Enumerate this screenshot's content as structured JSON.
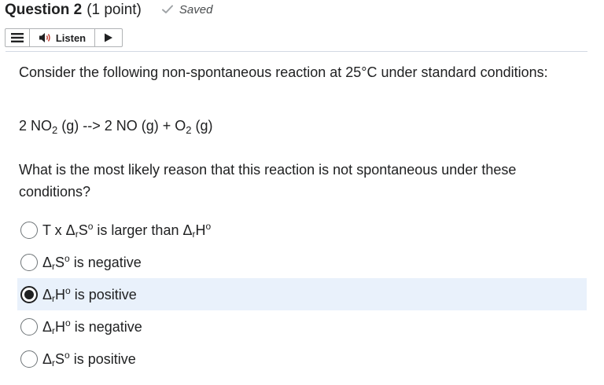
{
  "header": {
    "question_label": "Question 2",
    "points": "(1 point)",
    "saved_label": "Saved"
  },
  "listen": {
    "label": "Listen"
  },
  "question": {
    "intro": "Consider the following non-spontaneous reaction at 25°C under standard conditions:",
    "equation": {
      "reactant_coef": "2 NO",
      "reactant_sub": "2",
      "reactant_state": " (g) --> 2 NO (g) + O",
      "product_sub": "2",
      "product_state": " (g)"
    },
    "prompt": "What is the most likely reason that this reaction is not spontaneous under these conditions?"
  },
  "options": [
    {
      "pre": "T x Δ",
      "sub1": "r",
      "mid1": "S",
      "sup1": "o",
      "mid2": " is larger than Δ",
      "sub2": "r",
      "mid3": "H",
      "sup2": "o",
      "post": "",
      "selected": false
    },
    {
      "pre": "Δ",
      "sub1": "r",
      "mid1": "S",
      "sup1": "o",
      "mid2": " is negative",
      "sub2": "",
      "mid3": "",
      "sup2": "",
      "post": "",
      "selected": false
    },
    {
      "pre": "Δ",
      "sub1": "r",
      "mid1": "H",
      "sup1": "o",
      "mid2": " is positive",
      "sub2": "",
      "mid3": "",
      "sup2": "",
      "post": "",
      "selected": true
    },
    {
      "pre": "Δ",
      "sub1": "r",
      "mid1": "H",
      "sup1": "o",
      "mid2": " is negative",
      "sub2": "",
      "mid3": "",
      "sup2": "",
      "post": "",
      "selected": false
    },
    {
      "pre": "Δ",
      "sub1": "r",
      "mid1": "S",
      "sup1": "o",
      "mid2": " is positive",
      "sub2": "",
      "mid3": "",
      "sup2": "",
      "post": "",
      "selected": false
    }
  ],
  "icons": {
    "saved": "checkmark-icon",
    "menu": "hamburger-icon",
    "speaker": "speaker-icon",
    "play": "play-icon"
  },
  "colors": {
    "selected_background": "#e9f1fb",
    "text": "#202122"
  }
}
